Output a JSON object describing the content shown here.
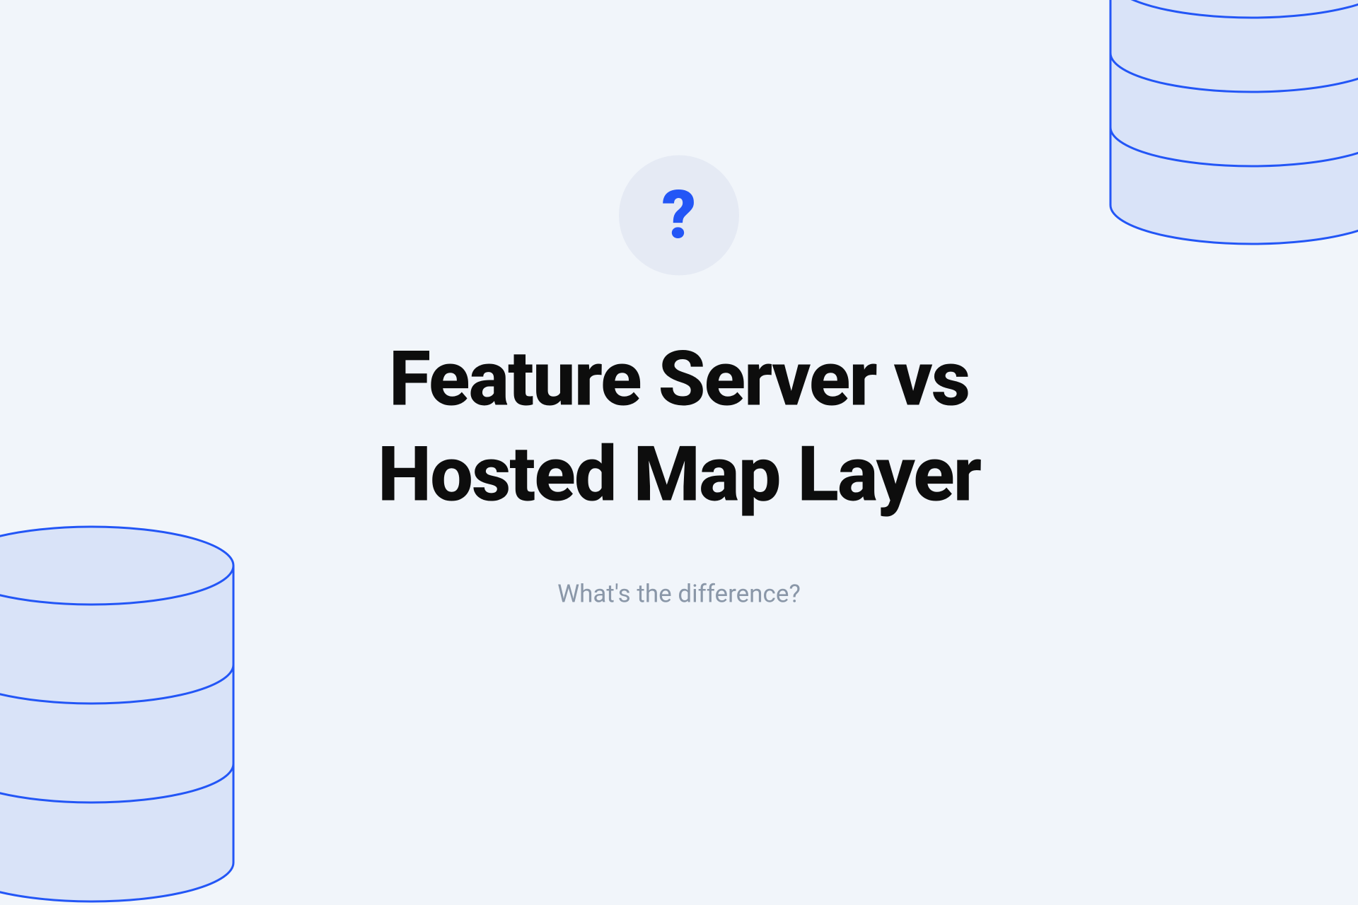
{
  "icon": {
    "symbol": "?"
  },
  "title": {
    "line1": "Feature Server vs",
    "line2": "Hosted Map Layer"
  },
  "subtitle": "What's the difference?"
}
